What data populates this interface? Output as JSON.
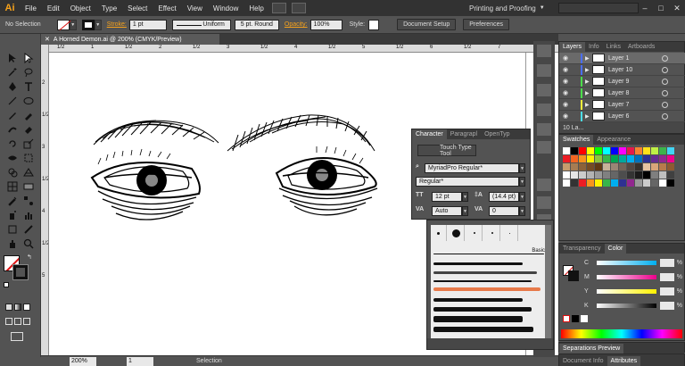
{
  "app": {
    "logo": "Ai"
  },
  "menu": [
    "File",
    "Edit",
    "Object",
    "Type",
    "Select",
    "Effect",
    "View",
    "Window",
    "Help"
  ],
  "workspace": "Printing and Proofing",
  "control": {
    "selection": "No Selection",
    "stroke_label": "Stroke:",
    "stroke_weight": "1 pt",
    "stroke_profile": "Uniform",
    "brush": "5 pt. Round",
    "opacity_label": "Opacity:",
    "opacity": "100%",
    "style_label": "Style:",
    "document_setup": "Document Setup",
    "preferences": "Preferences"
  },
  "document": {
    "tab_title": "A Horned Demon.ai @ 200% (CMYK/Preview)",
    "zoom": "200%",
    "page": "1",
    "status": "Selection"
  },
  "rulers": {
    "top": [
      "1/2",
      "1",
      "1/2",
      "2",
      "1/2",
      "3",
      "1/2",
      "4",
      "1/2",
      "5",
      "1/2",
      "6",
      "1/2",
      "7"
    ],
    "left": [
      "2",
      "1/2",
      "3",
      "1/2",
      "4",
      "1/2",
      "5"
    ]
  },
  "layers": {
    "tabs": [
      "Layers",
      "Info",
      "Links",
      "Artboards"
    ],
    "rows": [
      {
        "name": "Layer 1",
        "color": "#4b6ef5",
        "selected": true
      },
      {
        "name": "Layer 10",
        "color": "#4b6ef5",
        "selected": false
      },
      {
        "name": "Layer 9",
        "color": "#4bdd4b",
        "selected": false
      },
      {
        "name": "Layer 8",
        "color": "#4bdd4b",
        "selected": false
      },
      {
        "name": "Layer 7",
        "color": "#f5f53a",
        "selected": false
      },
      {
        "name": "Layer 6",
        "color": "#4bdde8",
        "selected": false
      }
    ],
    "footer": "10 La..."
  },
  "swatches": {
    "tabs": [
      "Swatches",
      "Appearance"
    ]
  },
  "color": {
    "tabs": [
      "Transparency",
      "Color"
    ],
    "channels": [
      {
        "label": "C",
        "pct": "%"
      },
      {
        "label": "M",
        "pct": "%"
      },
      {
        "label": "Y",
        "pct": "%"
      },
      {
        "label": "K",
        "pct": "%"
      }
    ]
  },
  "separations": "Separations Preview",
  "bottom_tabs": [
    "Document Info",
    "Attributes"
  ],
  "character": {
    "tabs": [
      "Character",
      "Paragrapl",
      "OpenTyp"
    ],
    "touch_type": "Touch Type Tool",
    "font": "MyriadPro Regular*",
    "style": "Regular*",
    "size": "12 pt",
    "leading": "(14.4 pt)",
    "kerning": "Auto",
    "tracking": "0"
  },
  "brushes": {
    "basic_label": "Basic"
  }
}
